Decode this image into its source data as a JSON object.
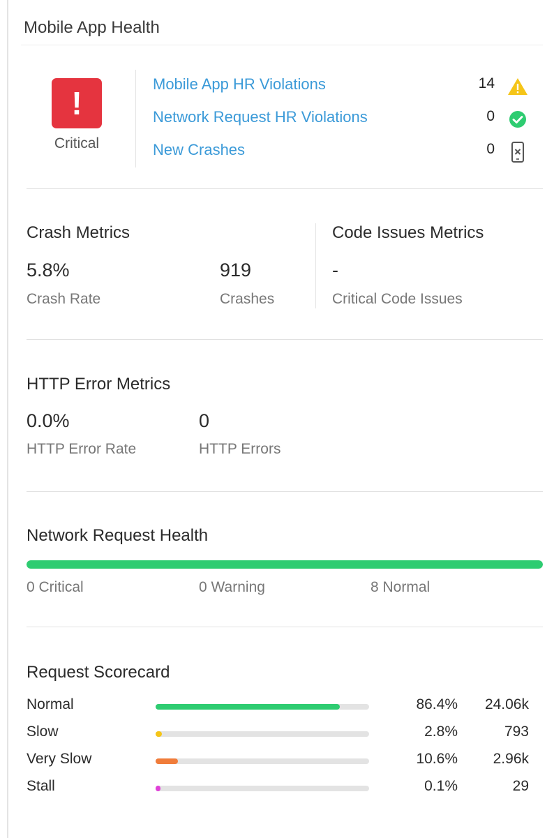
{
  "panel": {
    "title": "Mobile App Health"
  },
  "status": {
    "label": "Critical",
    "icon": "exclamation-icon",
    "glyph": "!",
    "color": "#e5343f"
  },
  "violations": [
    {
      "label": "Mobile App HR Violations",
      "count": "14",
      "icon": "warning-triangle-icon"
    },
    {
      "label": "Network Request HR Violations",
      "count": "0",
      "icon": "check-circle-icon"
    },
    {
      "label": "New Crashes",
      "count": "0",
      "icon": "mobile-crash-icon"
    }
  ],
  "crash_metrics": {
    "heading": "Crash Metrics",
    "rate_value": "5.8%",
    "rate_label": "Crash Rate",
    "count_value": "919",
    "count_label": "Crashes"
  },
  "code_issues": {
    "heading": "Code Issues Metrics",
    "value": "-",
    "label": "Critical Code Issues"
  },
  "http_errors": {
    "heading": "HTTP Error Metrics",
    "rate_value": "0.0%",
    "rate_label": "HTTP Error Rate",
    "count_value": "0",
    "count_label": "HTTP Errors"
  },
  "network_health": {
    "heading": "Network Request Health",
    "critical": "0 Critical",
    "warning": "0 Warning",
    "normal": "8 Normal",
    "normal_fraction": 1.0,
    "color": "#2ecc71"
  },
  "scorecard": {
    "heading": "Request Scorecard",
    "rows": [
      {
        "name": "Normal",
        "percent": "86.4%",
        "count": "24.06k",
        "fraction": 0.864,
        "color": "#2ecc71"
      },
      {
        "name": "Slow",
        "percent": "2.8%",
        "count": "793",
        "fraction": 0.028,
        "color": "#f5c518"
      },
      {
        "name": "Very Slow",
        "percent": "10.6%",
        "count": "2.96k",
        "fraction": 0.106,
        "color": "#f07c3a"
      },
      {
        "name": "Stall",
        "percent": "0.1%",
        "count": "29",
        "fraction": 0.001,
        "color": "#e040d8"
      }
    ]
  }
}
